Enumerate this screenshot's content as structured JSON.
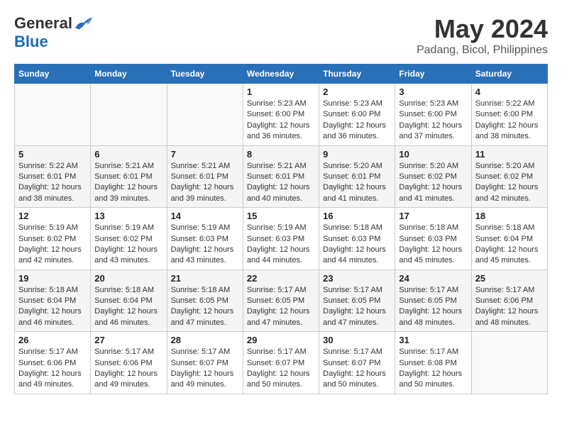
{
  "logo": {
    "general": "General",
    "blue": "Blue"
  },
  "title": "May 2024",
  "subtitle": "Padang, Bicol, Philippines",
  "days_header": [
    "Sunday",
    "Monday",
    "Tuesday",
    "Wednesday",
    "Thursday",
    "Friday",
    "Saturday"
  ],
  "weeks": [
    {
      "days": [
        {
          "num": "",
          "info": ""
        },
        {
          "num": "",
          "info": ""
        },
        {
          "num": "",
          "info": ""
        },
        {
          "num": "1",
          "info": "Sunrise: 5:23 AM\nSunset: 6:00 PM\nDaylight: 12 hours\nand 36 minutes."
        },
        {
          "num": "2",
          "info": "Sunrise: 5:23 AM\nSunset: 6:00 PM\nDaylight: 12 hours\nand 36 minutes."
        },
        {
          "num": "3",
          "info": "Sunrise: 5:23 AM\nSunset: 6:00 PM\nDaylight: 12 hours\nand 37 minutes."
        },
        {
          "num": "4",
          "info": "Sunrise: 5:22 AM\nSunset: 6:00 PM\nDaylight: 12 hours\nand 38 minutes."
        }
      ]
    },
    {
      "days": [
        {
          "num": "5",
          "info": "Sunrise: 5:22 AM\nSunset: 6:01 PM\nDaylight: 12 hours\nand 38 minutes."
        },
        {
          "num": "6",
          "info": "Sunrise: 5:21 AM\nSunset: 6:01 PM\nDaylight: 12 hours\nand 39 minutes."
        },
        {
          "num": "7",
          "info": "Sunrise: 5:21 AM\nSunset: 6:01 PM\nDaylight: 12 hours\nand 39 minutes."
        },
        {
          "num": "8",
          "info": "Sunrise: 5:21 AM\nSunset: 6:01 PM\nDaylight: 12 hours\nand 40 minutes."
        },
        {
          "num": "9",
          "info": "Sunrise: 5:20 AM\nSunset: 6:01 PM\nDaylight: 12 hours\nand 41 minutes."
        },
        {
          "num": "10",
          "info": "Sunrise: 5:20 AM\nSunset: 6:02 PM\nDaylight: 12 hours\nand 41 minutes."
        },
        {
          "num": "11",
          "info": "Sunrise: 5:20 AM\nSunset: 6:02 PM\nDaylight: 12 hours\nand 42 minutes."
        }
      ]
    },
    {
      "days": [
        {
          "num": "12",
          "info": "Sunrise: 5:19 AM\nSunset: 6:02 PM\nDaylight: 12 hours\nand 42 minutes."
        },
        {
          "num": "13",
          "info": "Sunrise: 5:19 AM\nSunset: 6:02 PM\nDaylight: 12 hours\nand 43 minutes."
        },
        {
          "num": "14",
          "info": "Sunrise: 5:19 AM\nSunset: 6:03 PM\nDaylight: 12 hours\nand 43 minutes."
        },
        {
          "num": "15",
          "info": "Sunrise: 5:19 AM\nSunset: 6:03 PM\nDaylight: 12 hours\nand 44 minutes."
        },
        {
          "num": "16",
          "info": "Sunrise: 5:18 AM\nSunset: 6:03 PM\nDaylight: 12 hours\nand 44 minutes."
        },
        {
          "num": "17",
          "info": "Sunrise: 5:18 AM\nSunset: 6:03 PM\nDaylight: 12 hours\nand 45 minutes."
        },
        {
          "num": "18",
          "info": "Sunrise: 5:18 AM\nSunset: 6:04 PM\nDaylight: 12 hours\nand 45 minutes."
        }
      ]
    },
    {
      "days": [
        {
          "num": "19",
          "info": "Sunrise: 5:18 AM\nSunset: 6:04 PM\nDaylight: 12 hours\nand 46 minutes."
        },
        {
          "num": "20",
          "info": "Sunrise: 5:18 AM\nSunset: 6:04 PM\nDaylight: 12 hours\nand 46 minutes."
        },
        {
          "num": "21",
          "info": "Sunrise: 5:18 AM\nSunset: 6:05 PM\nDaylight: 12 hours\nand 47 minutes."
        },
        {
          "num": "22",
          "info": "Sunrise: 5:17 AM\nSunset: 6:05 PM\nDaylight: 12 hours\nand 47 minutes."
        },
        {
          "num": "23",
          "info": "Sunrise: 5:17 AM\nSunset: 6:05 PM\nDaylight: 12 hours\nand 47 minutes."
        },
        {
          "num": "24",
          "info": "Sunrise: 5:17 AM\nSunset: 6:05 PM\nDaylight: 12 hours\nand 48 minutes."
        },
        {
          "num": "25",
          "info": "Sunrise: 5:17 AM\nSunset: 6:06 PM\nDaylight: 12 hours\nand 48 minutes."
        }
      ]
    },
    {
      "days": [
        {
          "num": "26",
          "info": "Sunrise: 5:17 AM\nSunset: 6:06 PM\nDaylight: 12 hours\nand 49 minutes."
        },
        {
          "num": "27",
          "info": "Sunrise: 5:17 AM\nSunset: 6:06 PM\nDaylight: 12 hours\nand 49 minutes."
        },
        {
          "num": "28",
          "info": "Sunrise: 5:17 AM\nSunset: 6:07 PM\nDaylight: 12 hours\nand 49 minutes."
        },
        {
          "num": "29",
          "info": "Sunrise: 5:17 AM\nSunset: 6:07 PM\nDaylight: 12 hours\nand 50 minutes."
        },
        {
          "num": "30",
          "info": "Sunrise: 5:17 AM\nSunset: 6:07 PM\nDaylight: 12 hours\nand 50 minutes."
        },
        {
          "num": "31",
          "info": "Sunrise: 5:17 AM\nSunset: 6:08 PM\nDaylight: 12 hours\nand 50 minutes."
        },
        {
          "num": "",
          "info": ""
        }
      ]
    }
  ]
}
